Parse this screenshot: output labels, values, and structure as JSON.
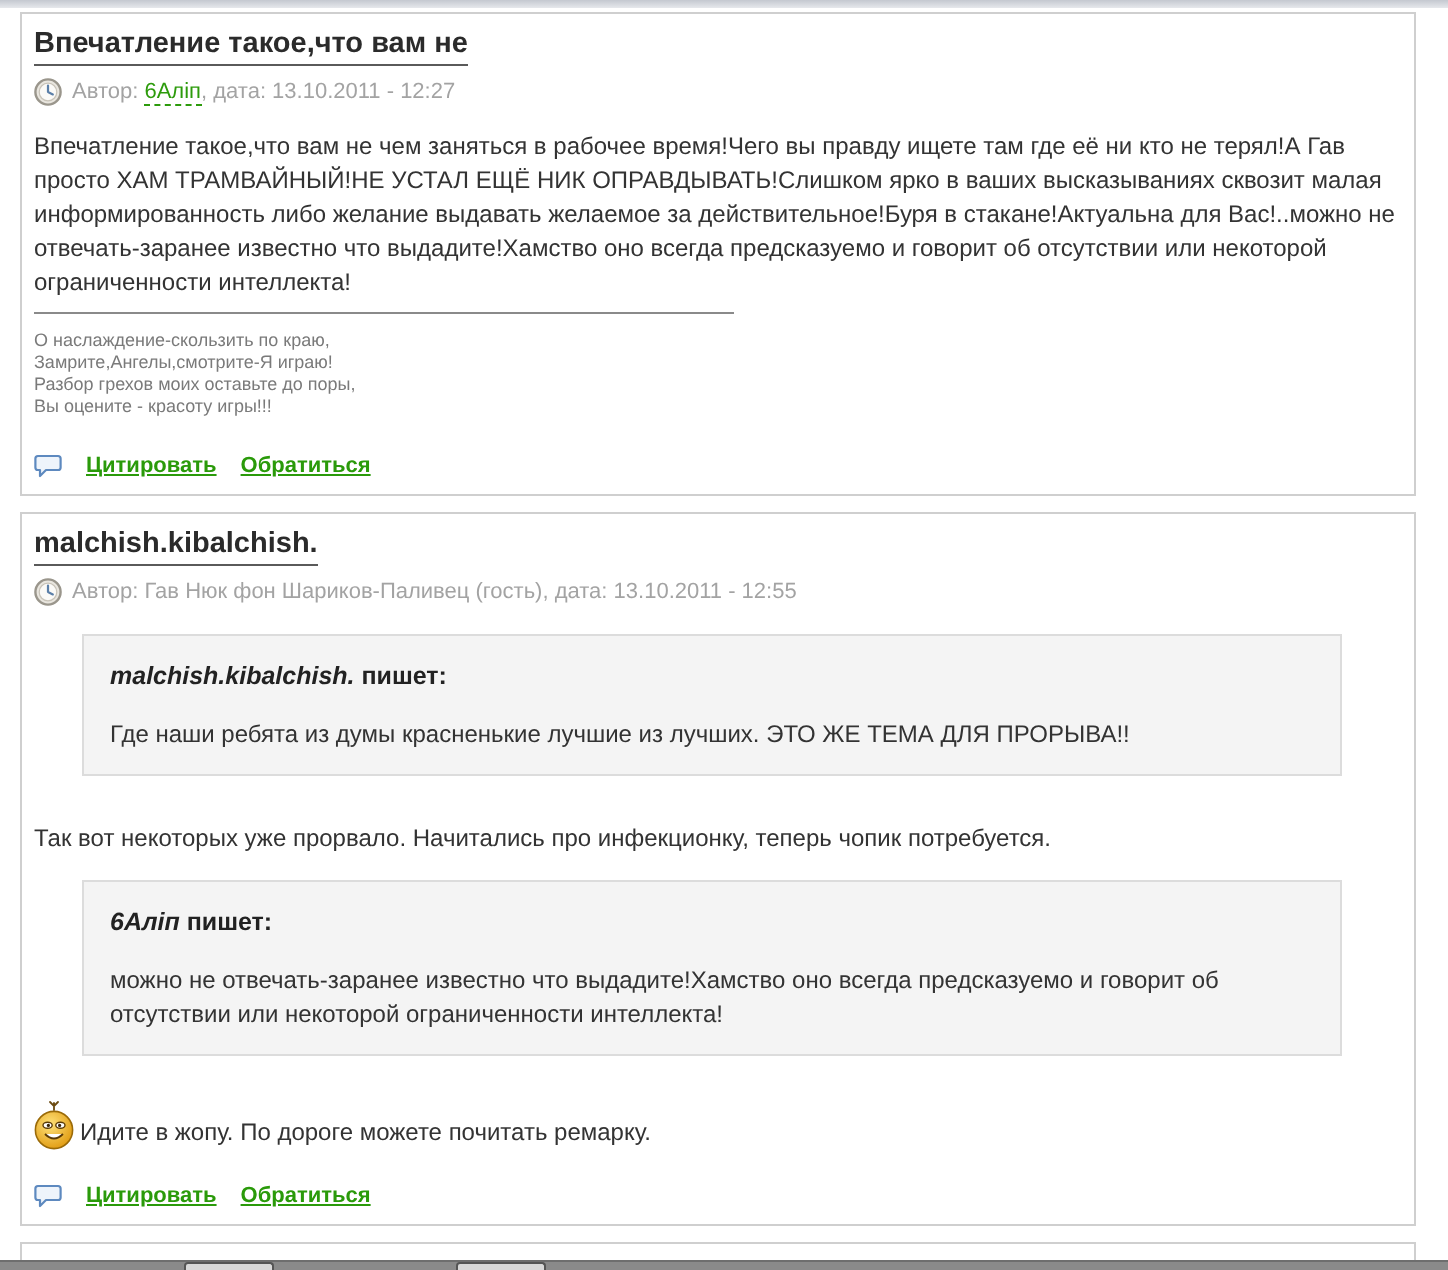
{
  "posts": [
    {
      "title": "Впечатление такое,что вам не",
      "meta": {
        "prefix": "Автор:",
        "author": {
          "name": "6Аліп",
          "registered": true
        },
        "suffix": ", дата: 13.10.2011 - 12:27"
      },
      "body": [
        {
          "kind": "paragraph",
          "text": "Впечатление такое,что вам не чем заняться в рабочее время!Чего вы правду ищете там где её ни кто не терял!А Гав просто ХАМ ТРАМВАЙНЫЙ!НЕ УСТАЛ ЕЩЁ НИК ОПРАВДЫВАТЬ!Слишком ярко в ваших высказываниях сквозит малая информированность либо желание выдавать желаемое за действительное!Буря в стакане!Актуальна для Вас!..можно не отвечать-заранее известно что выдадите!Хамство оно всегда предсказуемо и говорит об отсутствии или некоторой ограниченности интеллекта!"
        }
      ],
      "signature": [
        "О наслаждение-скользить по краю,",
        "Замрите,Ангелы,смотрите-Я играю!",
        "Разбор грехов моих оставьте до поры,",
        "Вы оцените - красоту игры!!!"
      ],
      "actions": [
        "Цитировать",
        "Обратиться"
      ]
    },
    {
      "title": "malchish.kibalchish.",
      "meta": {
        "prefix": "Автор:",
        "author": {
          "name": "Гав Нюк фон Шариков-Паливец (гость)",
          "registered": false
        },
        "suffix": ", дата: 13.10.2011 - 12:55"
      },
      "body": [
        {
          "kind": "quote",
          "header": "*malchish.kibalchish.* пишет:",
          "text": "Где наши ребята из думы красненькие лучшие из лучших. ЭТО ЖЕ ТЕМА ДЛЯ ПРОРЫВА!!"
        },
        {
          "kind": "paragraph",
          "text": "Так вот некоторых уже прорвало. Начитались про инфекционку, теперь чопик потребуется."
        },
        {
          "kind": "quote",
          "header": "*6Аліп* пишет:",
          "text": "можно не отвечать-заранее известно что выдадите!Хамство оно всегда предсказуемо и говорит об отсутствии или некоторой ограниченности интеллекта!"
        },
        {
          "kind": "smiley_paragraph",
          "text": "Идите в жопу. По дороге можете почитать ремарку."
        }
      ],
      "actions": [
        "Цитировать",
        "Обратиться"
      ]
    }
  ]
}
